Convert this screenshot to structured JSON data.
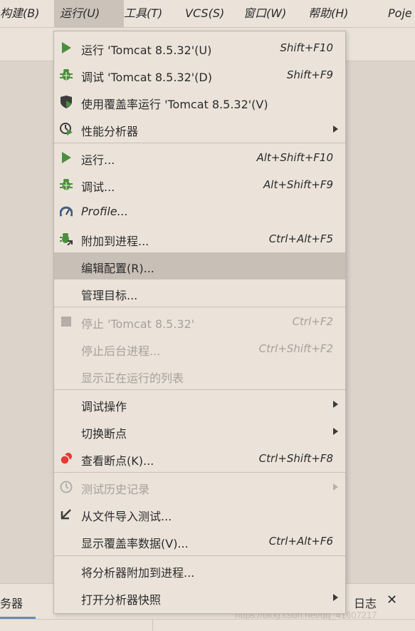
{
  "menubar": {
    "items": [
      {
        "label": "构建(B)"
      },
      {
        "label": "运行(U)"
      },
      {
        "label": "工具(T)"
      },
      {
        "label": "VCS(S)"
      },
      {
        "label": "窗口(W)"
      },
      {
        "label": "帮助(H)"
      },
      {
        "label": "Poje"
      }
    ]
  },
  "menu": {
    "items": [
      {
        "label": "运行 'Tomcat 8.5.32'(U)",
        "shortcut": "Shift+F10",
        "icon": "play-icon"
      },
      {
        "label": "调试 'Tomcat 8.5.32'(D)",
        "shortcut": "Shift+F9",
        "icon": "bug-icon"
      },
      {
        "label": "使用覆盖率运行  'Tomcat 8.5.32'(V)",
        "shortcut": "",
        "icon": "coverage-shield-icon"
      },
      {
        "label": "性能分析器",
        "shortcut": "",
        "icon": "profiler-clock-icon",
        "submenu": true
      },
      {
        "label": "运行...",
        "shortcut": "Alt+Shift+F10",
        "icon": "play-icon"
      },
      {
        "label": "调试...",
        "shortcut": "Alt+Shift+F9",
        "icon": "bug-icon"
      },
      {
        "label": "Profile...",
        "shortcut": "",
        "icon": "gauge-icon"
      },
      {
        "label": "附加到进程...",
        "shortcut": "Ctrl+Alt+F5",
        "icon": "attach-bug-icon"
      },
      {
        "label": "编辑配置(R)...",
        "shortcut": "",
        "icon": ""
      },
      {
        "label": "管理目标...",
        "shortcut": "",
        "icon": ""
      },
      {
        "label": "停止 'Tomcat 8.5.32'",
        "shortcut": "Ctrl+F2",
        "icon": "stop-icon"
      },
      {
        "label": "停止后台进程...",
        "shortcut": "Ctrl+Shift+F2",
        "icon": ""
      },
      {
        "label": "显示正在运行的列表",
        "shortcut": "",
        "icon": ""
      },
      {
        "label": "调试操作",
        "shortcut": "",
        "icon": "",
        "submenu": true
      },
      {
        "label": "切换断点",
        "shortcut": "",
        "icon": "",
        "submenu": true
      },
      {
        "label": "查看断点(K)...",
        "shortcut": "Ctrl+Shift+F8",
        "icon": "breakpoints-icon"
      },
      {
        "label": "测试历史记录",
        "shortcut": "",
        "icon": "history-clock-icon",
        "submenu": true
      },
      {
        "label": "从文件导入测试...",
        "shortcut": "",
        "icon": "import-arrow-icon"
      },
      {
        "label": "显示覆盖率数据(V)...",
        "shortcut": "Ctrl+Alt+F6",
        "icon": ""
      },
      {
        "label": "将分析器附加到进程...",
        "shortcut": "",
        "icon": ""
      },
      {
        "label": "打开分析器快照",
        "shortcut": "",
        "icon": "",
        "submenu": true
      }
    ]
  },
  "bottom": {
    "left_tab": "务器",
    "right_tab": "日志",
    "close": "✕"
  },
  "watermark": "https://blog.csdn.net/qq_41607217",
  "colors": {
    "accent_green": "#4b8f3d",
    "highlight": "#c8bfb7",
    "red": "#e53935"
  }
}
